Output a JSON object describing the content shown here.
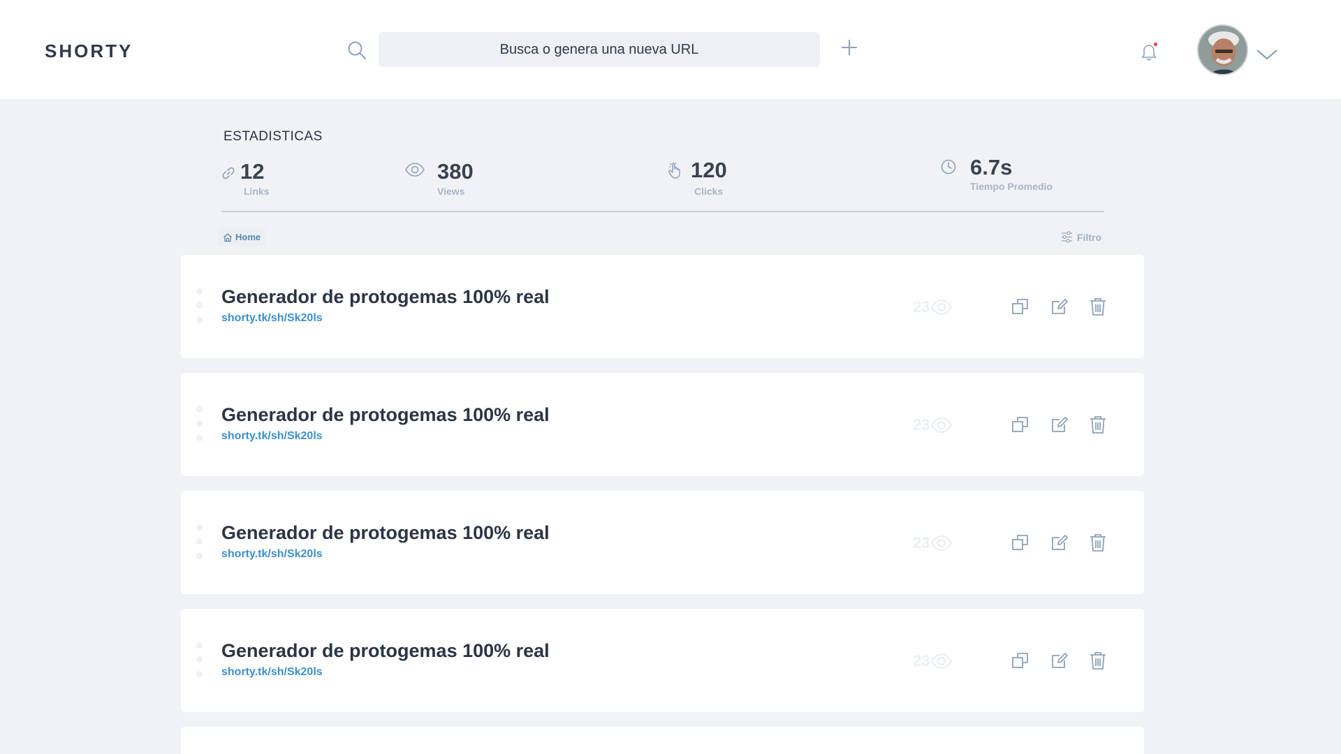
{
  "header": {
    "logo": "SHORTY",
    "search_placeholder": "Busca o genera una nueva URL",
    "icons": [
      "search-icon",
      "plus-icon",
      "bell-icon",
      "chevron-down-icon"
    ],
    "notification_dot_color": "#e53e3e"
  },
  "stats": {
    "title": "ESTADISTICAS",
    "items": [
      {
        "value": "12",
        "label": "Links",
        "icon": "link-icon"
      },
      {
        "value": "380",
        "label": "Views",
        "icon": "eye-icon"
      },
      {
        "value": "120",
        "label": "Clicks",
        "icon": "click-icon"
      },
      {
        "value": "6.7s",
        "label": "Tiempo Promedio",
        "icon": "clock-icon"
      }
    ]
  },
  "breadcrumb": {
    "home": "Home"
  },
  "filter": {
    "label": "Filtro"
  },
  "links": [
    {
      "title": "Generador de protogemas 100% real",
      "url": "shorty.tk/sh/Sk20ls",
      "views": "23"
    },
    {
      "title": "Generador de protogemas 100% real",
      "url": "shorty.tk/sh/Sk20ls",
      "views": "23"
    },
    {
      "title": "Generador de protogemas 100% real",
      "url": "shorty.tk/sh/Sk20ls",
      "views": "23"
    },
    {
      "title": "Generador de protogemas 100% real",
      "url": "shorty.tk/sh/Sk20ls",
      "views": "23"
    },
    {
      "title": "",
      "url": "",
      "views": ""
    }
  ],
  "colors": {
    "accent": "#3c8fcf",
    "icon": "#8ea1b9",
    "background": "#f1f2f6"
  }
}
